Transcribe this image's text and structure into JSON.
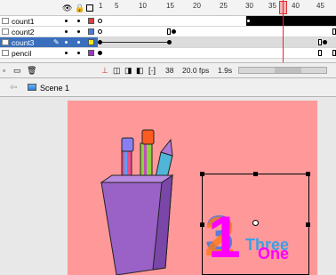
{
  "timeline": {
    "ruler": [
      "1",
      "5",
      "10",
      "15",
      "20",
      "25",
      "30",
      "35",
      "40",
      "45"
    ],
    "layers": [
      {
        "name": "count1",
        "swatch": "#e23c3c"
      },
      {
        "name": "count2",
        "swatch": "#4a7be0"
      },
      {
        "name": "count3",
        "swatch": "#f2e81c"
      },
      {
        "name": "pencil",
        "swatch": "#9b37c9"
      }
    ],
    "footer": {
      "frame": "38",
      "fps": "20.0 fps",
      "time": "1.9s"
    }
  },
  "editbar": {
    "scene": "Scene 1"
  },
  "colors": {
    "stage": "#ff9999",
    "selected_layer": "#3a6fbd",
    "playhead": "#e23c3c"
  }
}
